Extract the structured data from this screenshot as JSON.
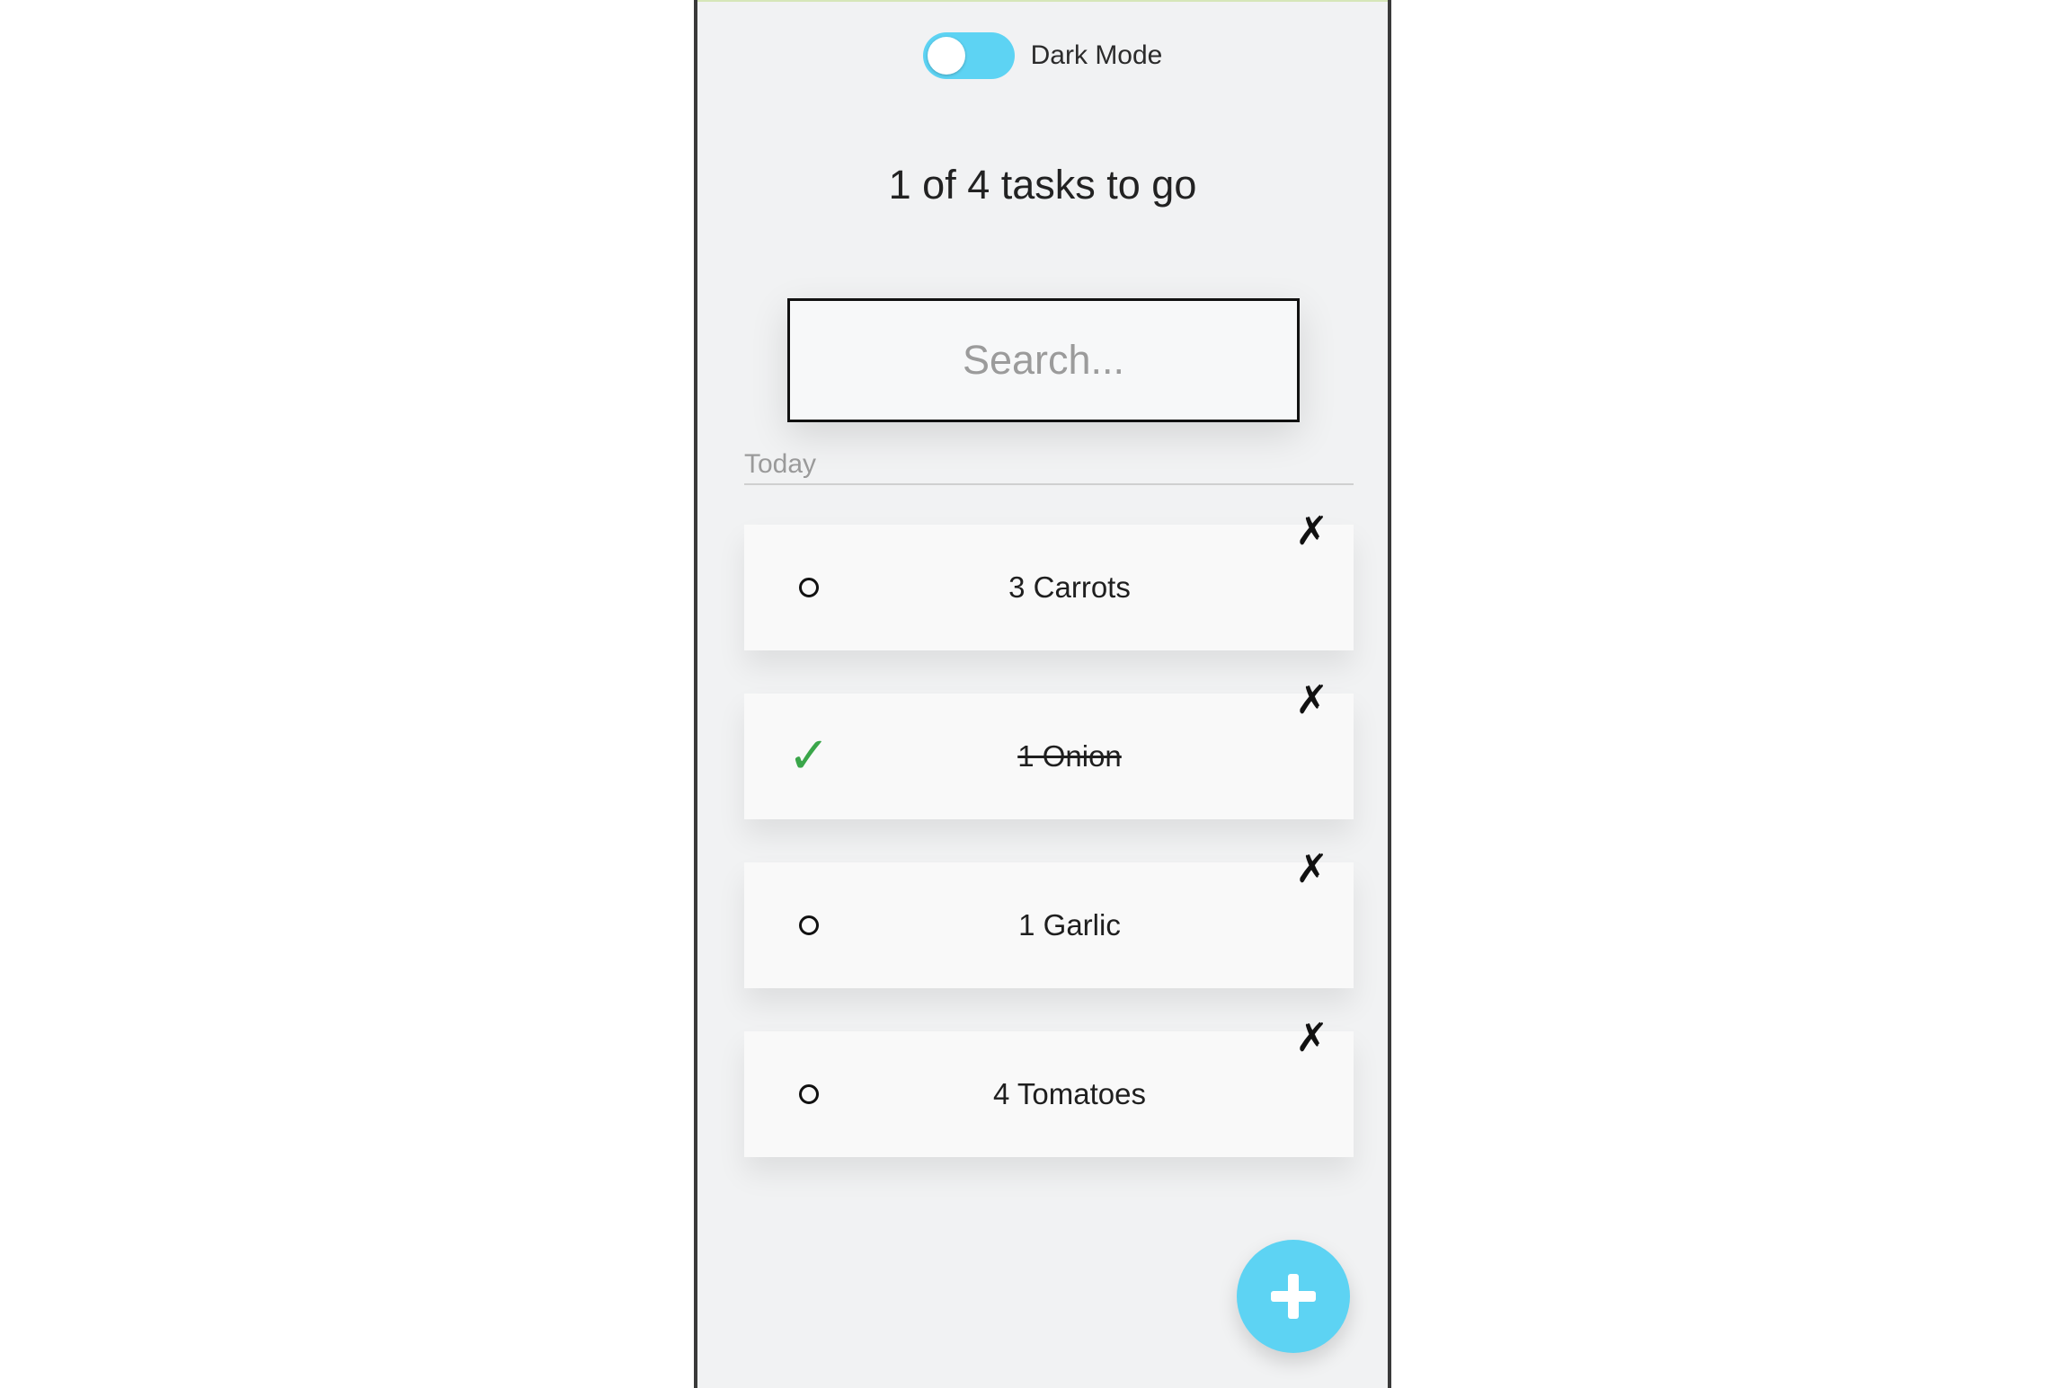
{
  "header": {
    "dark_mode_label": "Dark Mode",
    "summary": "1 of 4 tasks to go"
  },
  "search": {
    "placeholder": "Search...",
    "value": ""
  },
  "section": {
    "title": "Today"
  },
  "tasks": [
    {
      "label": "3 Carrots",
      "done": false
    },
    {
      "label": "1 Onion",
      "done": true
    },
    {
      "label": "1 Garlic",
      "done": false
    },
    {
      "label": "4 Tomatoes",
      "done": false
    }
  ],
  "icons": {
    "delete": "✗",
    "check": "✓",
    "add": "plus-icon"
  },
  "colors": {
    "accent": "#5dd3f3",
    "check": "#3aa64a",
    "background": "#f1f2f3",
    "card": "#f9f9f9"
  }
}
